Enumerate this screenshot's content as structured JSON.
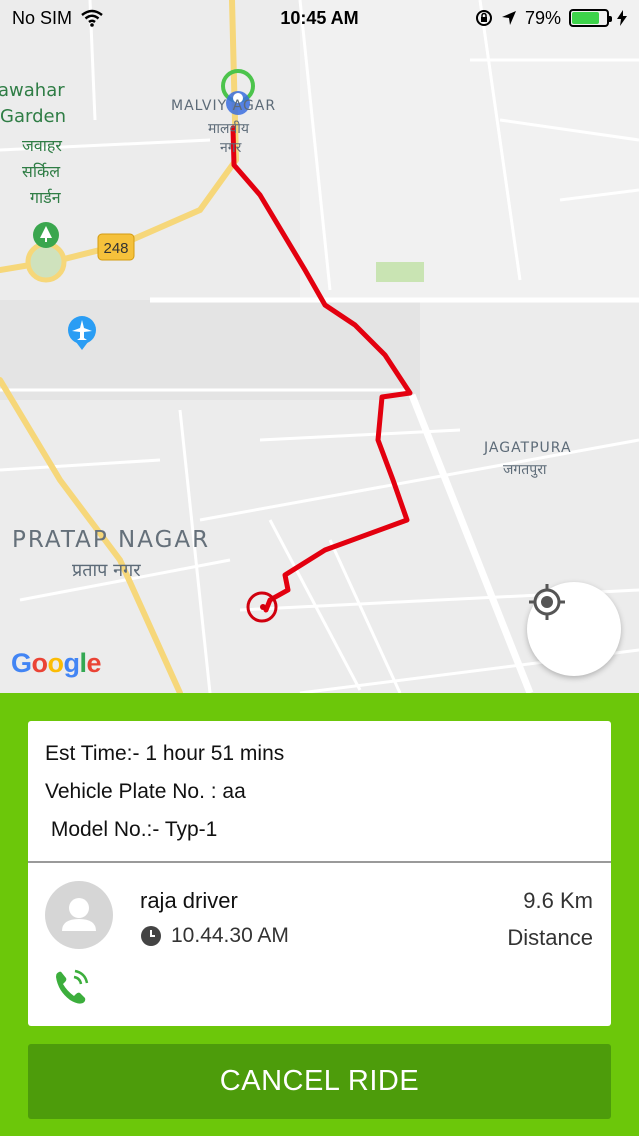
{
  "status_bar": {
    "carrier": "No SIM",
    "time": "10:45 AM",
    "battery": "79%",
    "battery_level": 0.79,
    "battery_color": "#3dd34a"
  },
  "map": {
    "labels": {
      "jawahar_en_1": "awahar",
      "jawahar_en_2": "Garden",
      "jawahar_hi_1": "जवाहर",
      "jawahar_hi_2": "सर्किल",
      "jawahar_hi_3": "गार्डन",
      "malviya_en": "MALVIY    AGAR",
      "malviya_hi_1": "मालवीय",
      "malviya_hi_2": "नगर",
      "highway": "248",
      "jagatpura_en": "JAGATPURA",
      "jagatpura_hi": "जगतपुरा",
      "pratap_en": "PRATAP NAGAR",
      "pratap_hi": "प्रताप नगर"
    },
    "google_logo": "Google",
    "route_color": "#e3000f",
    "map_background": "#ececec",
    "locate_icon": "crosshair-icon"
  },
  "ride": {
    "est_time": "Est Time:-  1 hour 51 mins",
    "vehicle_plate": "Vehicle Plate No. : aa",
    "model_no": " Model No.:- Typ-1",
    "driver_name": "raja driver",
    "time": "10.44.30 AM",
    "distance_value": "9.6 Km",
    "distance_label": "Distance",
    "cancel_label": "CANCEL RIDE",
    "accent_color": "#6cc70a",
    "button_color": "#4d9c0b"
  }
}
